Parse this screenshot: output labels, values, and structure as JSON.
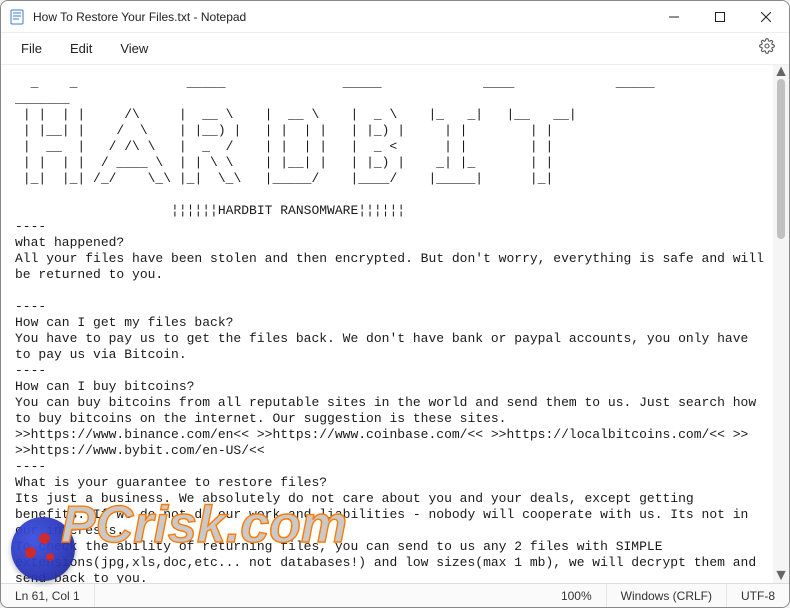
{
  "window": {
    "title": "How To Restore Your Files.txt - Notepad"
  },
  "menu": {
    "file": "File",
    "edit": "Edit",
    "view": "View"
  },
  "body_text": "  _    _              _____               _____             ____             _____           _______\n | |  | |     /\\     |  __ \\    |  __ \\    |  _ \\    |_   _|   |__   __|\n | |__| |    /  \\    | |__) |   | |  | |   | |_) |     | |        | |\n |  __  |   / /\\ \\   |  _  /    | |  | |   |  _ <      | |        | |\n | |  | |  / ____ \\  | | \\ \\    | |__| |   | |_) |    _| |_       | |\n |_|  |_| /_/    \\_\\ |_|  \\_\\   |_____/    |____/    |_____|      |_|\n\n                    ¦¦¦¦¦¦HARDBIT RANSOMWARE¦¦¦¦¦¦\n----\nwhat happened?\nAll your files have been stolen and then encrypted. But don't worry, everything is safe and will be returned to you.\n\n----\nHow can I get my files back?\nYou have to pay us to get the files back. We don't have bank or paypal accounts, you only have to pay us via Bitcoin.\n----\nHow can I buy bitcoins?\nYou can buy bitcoins from all reputable sites in the world and send them to us. Just search how to buy bitcoins on the internet. Our suggestion is these sites.\n>>https://www.binance.com/en<< >>https://www.coinbase.com/<< >>https://localbitcoins.com/<< >>\n>>https://www.bybit.com/en-US/<<\n----\nWhat is your guarantee to restore files?\nIts just a business. We absolutely do not care about you and your deals, except getting benefits. If we do not do our work and liabilities - nobody will cooperate with us. Its not in our interests.\nTo check the ability of returning files, you can send to us any 2 files with SIMPLE extensions(jpg,xls,doc,etc... not databases!) and low sizes(max 1 mb), we will decrypt them and send back to you.\nThat is our guarantee.\n\nHow to contact with you?\nYou can contact us by email:>>boos@keemail.me<< or >>boos@cyberfear.com<<",
  "status": {
    "position": "Ln 61, Col 1",
    "zoom": "100%",
    "line_ending": "Windows (CRLF)",
    "encoding": "UTF-8"
  },
  "watermark": {
    "text": "PCrisk.com"
  }
}
